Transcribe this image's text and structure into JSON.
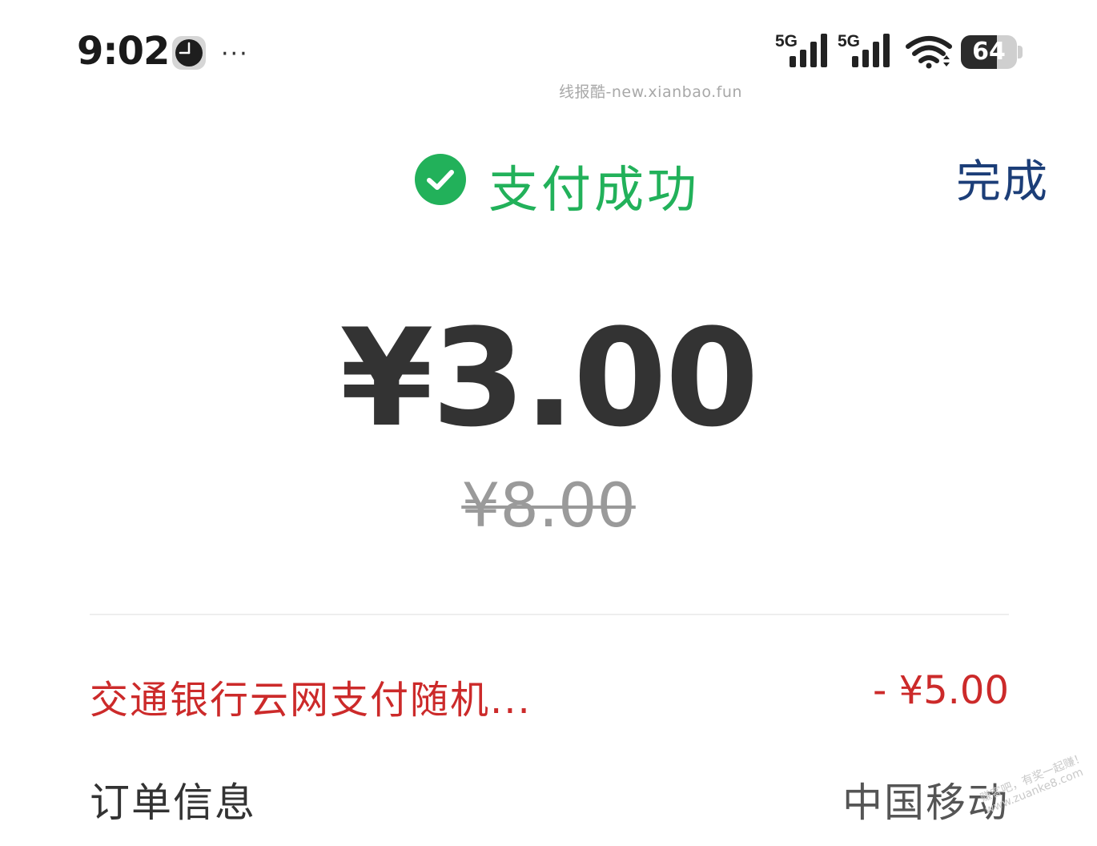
{
  "status_bar": {
    "time": "9:02",
    "clock_icon": "clock-icon",
    "more_icon": "more-dots-icon",
    "more_text": "···",
    "signal_1_label": "5G",
    "signal_2_label": "5G",
    "wifi_icon": "wifi-icon",
    "battery_level": 64,
    "battery_text": "64"
  },
  "watermark_top": "线报酷-new.xianbao.fun",
  "header": {
    "success_icon": "check-circle-icon",
    "title": "支付成功",
    "done_label": "完成",
    "success_color": "#22b15a",
    "done_color": "#1c3e78"
  },
  "payment": {
    "amount": "¥3.00",
    "original_amount": "¥8.00"
  },
  "discount": {
    "label": "交通银行云网支付随机...",
    "amount": "- ¥5.00",
    "color": "#cc2a2a"
  },
  "order": {
    "label": "订单信息",
    "value": "中国移动"
  },
  "watermark_bottom": {
    "line1": "赚客吧，有奖一起赚！",
    "line2": "www.zuanke8.com"
  }
}
